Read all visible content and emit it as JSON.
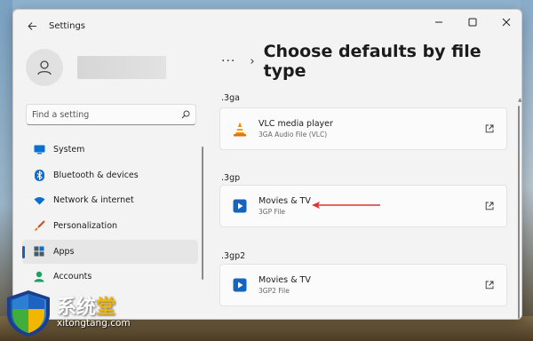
{
  "window": {
    "title": "Settings",
    "controls": {
      "minimize": "—",
      "maximize": "☐",
      "close": "✕"
    }
  },
  "sidebar": {
    "search_placeholder": "Find a setting",
    "items": [
      {
        "label": "System",
        "icon": "monitor-icon",
        "active": false
      },
      {
        "label": "Bluetooth & devices",
        "icon": "bluetooth-icon",
        "active": false
      },
      {
        "label": "Network & internet",
        "icon": "wifi-icon",
        "active": false
      },
      {
        "label": "Personalization",
        "icon": "brush-icon",
        "active": false
      },
      {
        "label": "Apps",
        "icon": "apps-icon",
        "active": true
      },
      {
        "label": "Accounts",
        "icon": "person-icon",
        "active": false
      }
    ]
  },
  "main": {
    "breadcrumb_more": "···",
    "breadcrumb_sep": "›",
    "title": "Choose defaults by file type",
    "sections": [
      {
        "ext": ".3ga",
        "app": "VLC media player",
        "desc": "3GA Audio File (VLC)",
        "icon": "vlc-cone-icon"
      },
      {
        "ext": ".3gp",
        "app": "Movies & TV",
        "desc": "3GP File",
        "icon": "movies-tv-icon"
      },
      {
        "ext": ".3gp2",
        "app": "Movies & TV",
        "desc": "3GP2 File",
        "icon": "movies-tv-icon"
      }
    ]
  },
  "watermark": {
    "cn_main": "系统",
    "cn_highlight": "堂",
    "url": "xitongtang.com"
  },
  "colors": {
    "accent": "#1a5fb4",
    "annotation_arrow": "#d9352a",
    "vlc_orange": "#f08a00",
    "movies_blue": "#1565c0"
  }
}
